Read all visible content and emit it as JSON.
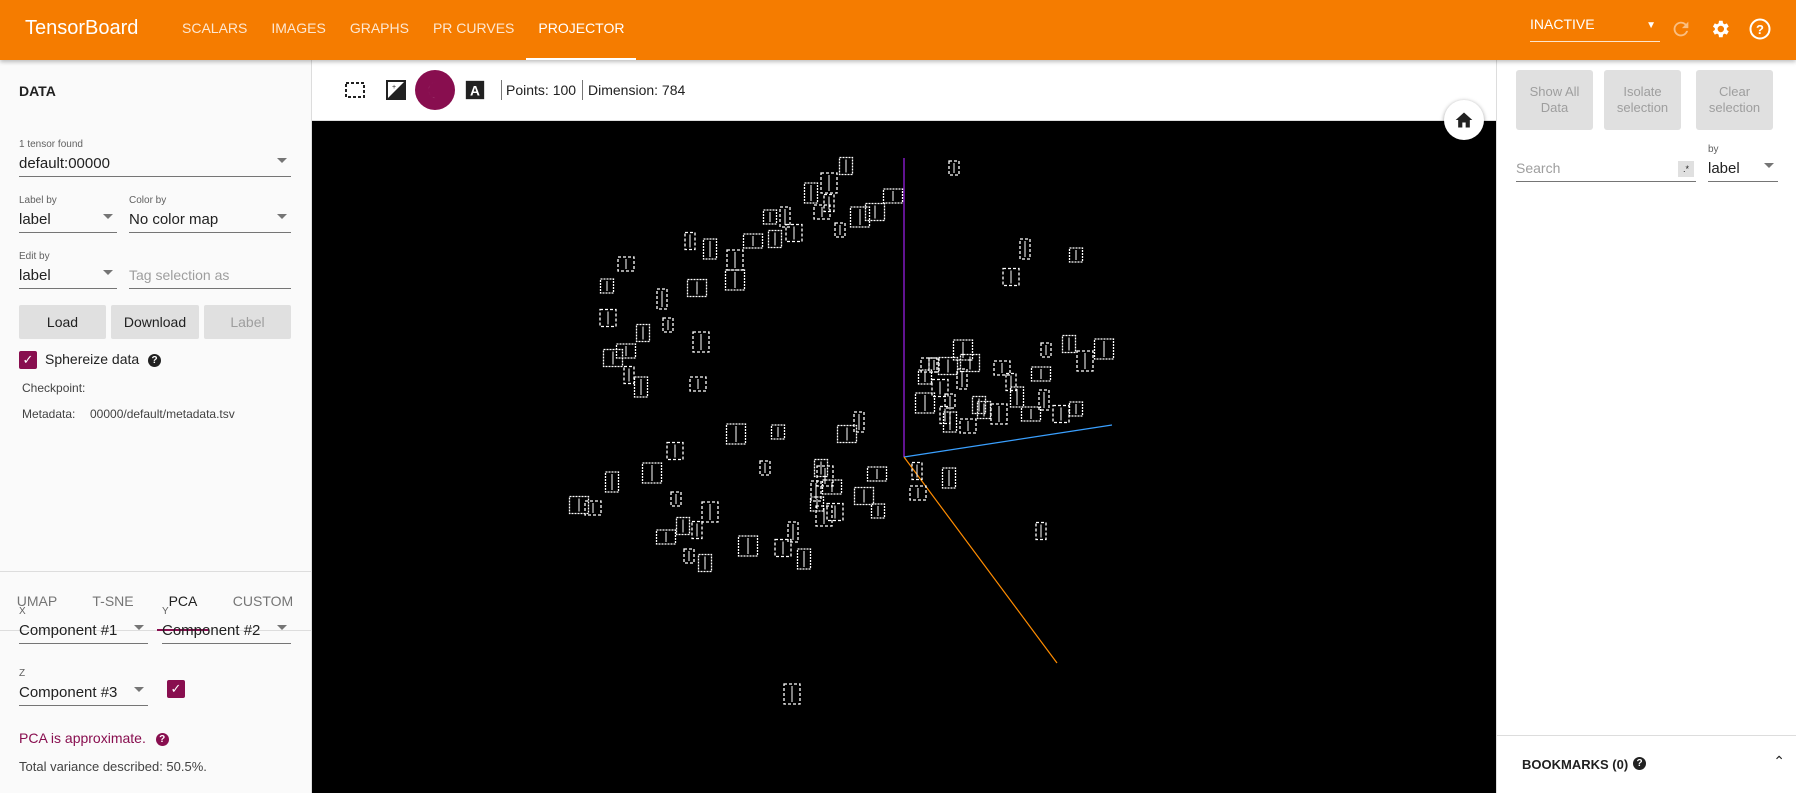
{
  "app": {
    "brand": "TensorBoard",
    "tabs": [
      {
        "label": "SCALARS",
        "active": false
      },
      {
        "label": "IMAGES",
        "active": false
      },
      {
        "label": "GRAPHS",
        "active": false
      },
      {
        "label": "PR CURVES",
        "active": false
      },
      {
        "label": "PROJECTOR",
        "active": true
      }
    ],
    "status_select": "INACTIVE",
    "icons": [
      "refresh-icon",
      "settings-gear-icon",
      "help-icon"
    ]
  },
  "data_panel": {
    "title": "DATA",
    "tensor_count_label": "1 tensor found",
    "tensor_value": "default:00000",
    "label_by_label": "Label by",
    "label_by_value": "label",
    "color_by_label": "Color by",
    "color_by_value": "No color map",
    "edit_by_label": "Edit by",
    "edit_by_value": "label",
    "tag_placeholder": "Tag selection as",
    "load_button": "Load",
    "download_button": "Download",
    "label_button": "Label",
    "sphereize_label": "Sphereize data",
    "sphereize_checked": true,
    "checkpoint_label": "Checkpoint:",
    "checkpoint_value": "",
    "metadata_label": "Metadata:",
    "metadata_value": "00000/default/metadata.tsv"
  },
  "projection_tabs": [
    {
      "label": "UMAP",
      "active": false
    },
    {
      "label": "T-SNE",
      "active": false
    },
    {
      "label": "PCA",
      "active": true
    },
    {
      "label": "CUSTOM",
      "active": false
    }
  ],
  "pca": {
    "x_label": "X",
    "x_value": "Component #1",
    "y_label": "Y",
    "y_value": "Component #2",
    "z_label": "Z",
    "z_value": "Component #3",
    "z_enabled": true,
    "approx_text": "PCA is approximate.",
    "variance_text": "Total variance described: 50.5%."
  },
  "toolbar": {
    "icons": [
      "select-rectangle-icon",
      "night-mode-contrast-icon",
      "moon-icon",
      "label-text-icon"
    ],
    "points_text": "Points: 100",
    "dimension_text": "Dimension: 784"
  },
  "inspector": {
    "show_all_button": "Show All Data",
    "isolate_button": "Isolate selection",
    "clear_button": "Clear selection",
    "search_placeholder": "Search",
    "regex_toggle": ".*",
    "by_label": "by",
    "by_value": "label",
    "bookmarks_label": "BOOKMARKS (0)"
  },
  "colors": {
    "header": "#f57c00",
    "accent": "#880e4f",
    "canvas": "#000000"
  }
}
